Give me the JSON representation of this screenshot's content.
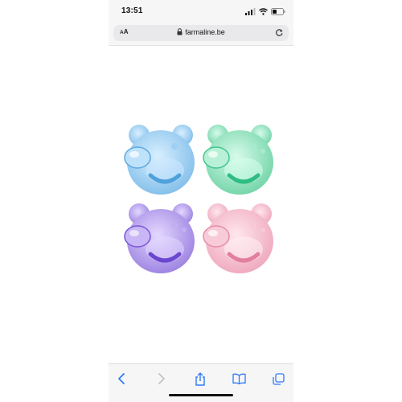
{
  "status_bar": {
    "time": "13:51",
    "icons": [
      "signal-icon",
      "wifi-icon",
      "battery-icon"
    ]
  },
  "address_bar": {
    "text_size_label_small": "A",
    "text_size_label_large": "A",
    "url": "farmaline.be",
    "icons": [
      "lock-icon",
      "reload-icon"
    ]
  },
  "product": {
    "image_subject": "four bear-shaped pacifiers",
    "colors": {
      "blue": "#8ec8ee",
      "green": "#7fdcb4",
      "purple": "#a88ee6",
      "pink": "#f3b6c7"
    }
  },
  "toolbar": {
    "icons": [
      "back-icon",
      "forward-icon",
      "share-icon",
      "bookmarks-icon",
      "tabs-icon"
    ],
    "forward_enabled": false
  },
  "theme": {
    "accent": "#2f7bf6",
    "bar_background": "#f6f6f7"
  }
}
